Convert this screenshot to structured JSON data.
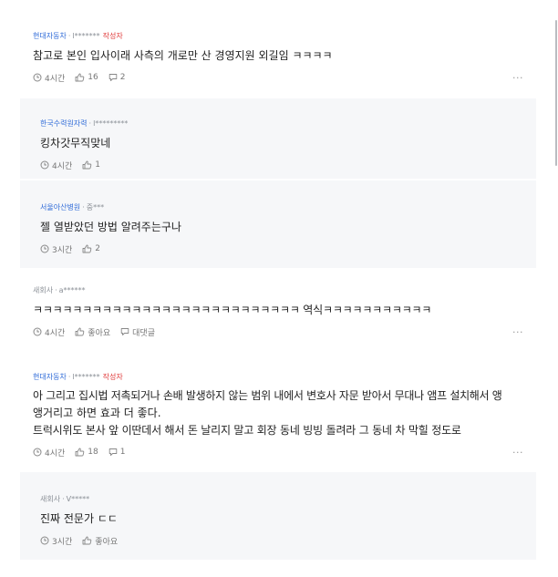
{
  "comments": [
    {
      "company": "현대자동차",
      "author": "l*******",
      "author_tag": "작성자",
      "lines": [
        "참고로 본인 입사이래 사측의 개로만 산 경영지원 외길임 ㅋㅋㅋㅋ"
      ],
      "time": "4시간",
      "likes": "16",
      "replies": "2",
      "more": "···"
    },
    {
      "company": "한국수력원자력",
      "author": "l*********",
      "lines": [
        "킹차갓무직맞네"
      ],
      "time": "4시간",
      "likes": "1"
    },
    {
      "company": "서울아산병원",
      "author": "중***",
      "lines": [
        "젤 열받았던 방법 알려주는구나"
      ],
      "time": "3시간",
      "likes": "2"
    },
    {
      "company": "새회사",
      "author": "a******",
      "lines": [
        "ㅋㅋㅋㅋㅋㅋㅋㅋㅋㅋㅋㅋㅋㅋㅋㅋㅋㅋㅋㅋㅋㅋㅋㅋㅋㅋㅋ 역식ㅋㅋㅋㅋㅋㅋㅋㅋㅋㅋㅋ"
      ],
      "time": "4시간",
      "like_label": "좋아요",
      "reply_label": "대댓글",
      "more": "···"
    },
    {
      "company": "현대자동차",
      "author": "l*******",
      "author_tag": "작성자",
      "lines": [
        "아 그리고 집시법 저촉되거나 손배 발생하지 않는 범위 내에서 변호사 자문 받아서 무대나 앰프 설치해서 앵",
        "앵거리고 하면 효과 더 좋다.",
        "트럭시위도 본사 앞 이딴데서 해서 돈 날리지 말고 회장 동네 빙빙 돌려라 그 동네 차 막힐 정도로"
      ],
      "time": "4시간",
      "likes": "18",
      "replies": "1",
      "more": "···"
    },
    {
      "company": "새회사",
      "author": "V*****",
      "lines": [
        "진짜 전문가 ㄷㄷ"
      ],
      "time": "3시간",
      "like_label": "좋아요"
    }
  ],
  "colors": {
    "company_blue": "#2f6bd8",
    "author_tag_red": "#e03b3b",
    "reply_bg": "#f6f7f9"
  }
}
